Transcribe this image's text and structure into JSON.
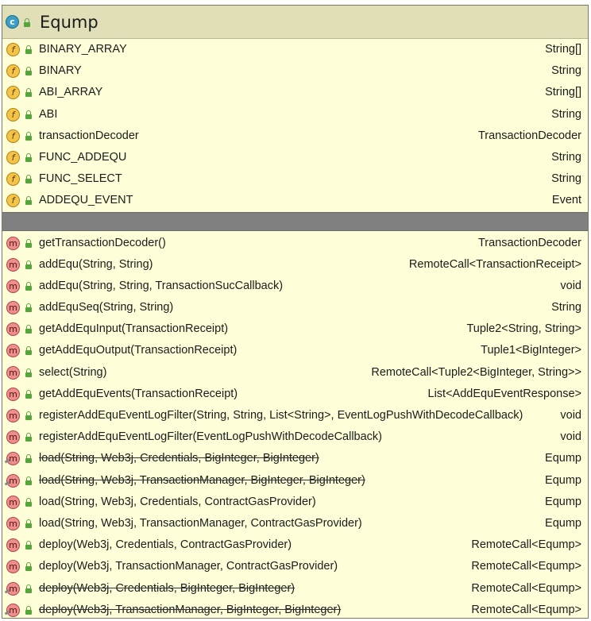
{
  "class": {
    "name": "Eqump",
    "icon": "class-icon",
    "icon_letter": "c"
  },
  "fields": [
    {
      "name": "BINARY_ARRAY",
      "type": "String[]"
    },
    {
      "name": "BINARY",
      "type": "String"
    },
    {
      "name": "ABI_ARRAY",
      "type": "String[]"
    },
    {
      "name": "ABI",
      "type": "String"
    },
    {
      "name": "transactionDecoder",
      "type": "TransactionDecoder"
    },
    {
      "name": "FUNC_ADDEQU",
      "type": "String"
    },
    {
      "name": "FUNC_SELECT",
      "type": "String"
    },
    {
      "name": "ADDEQU_EVENT",
      "type": "Event"
    }
  ],
  "methods": [
    {
      "name": "getTransactionDecoder()",
      "type": "TransactionDecoder",
      "deprecated": false
    },
    {
      "name": "addEqu(String, String)",
      "type": "RemoteCall<TransactionReceipt>",
      "deprecated": false
    },
    {
      "name": "addEqu(String, String, TransactionSucCallback)",
      "type": "void",
      "deprecated": false
    },
    {
      "name": "addEquSeq(String, String)",
      "type": "String",
      "deprecated": false
    },
    {
      "name": "getAddEquInput(TransactionReceipt)",
      "type": "Tuple2<String, String>",
      "deprecated": false
    },
    {
      "name": "getAddEquOutput(TransactionReceipt)",
      "type": "Tuple1<BigInteger>",
      "deprecated": false
    },
    {
      "name": "select(String)",
      "type": "RemoteCall<Tuple2<BigInteger, String>>",
      "deprecated": false
    },
    {
      "name": "getAddEquEvents(TransactionReceipt)",
      "type": "List<AddEquEventResponse>",
      "deprecated": false
    },
    {
      "name": "registerAddEquEventLogFilter(String, String, List<String>, EventLogPushWithDecodeCallback)",
      "type": "void",
      "deprecated": false
    },
    {
      "name": "registerAddEquEventLogFilter(EventLogPushWithDecodeCallback)",
      "type": "void",
      "deprecated": false
    },
    {
      "name": "load(String, Web3j, Credentials, BigInteger, BigInteger)",
      "type": "Eqump",
      "deprecated": true
    },
    {
      "name": "load(String, Web3j, TransactionManager, BigInteger, BigInteger)",
      "type": "Eqump",
      "deprecated": true
    },
    {
      "name": "load(String, Web3j, Credentials, ContractGasProvider)",
      "type": "Eqump",
      "deprecated": false
    },
    {
      "name": "load(String, Web3j, TransactionManager, ContractGasProvider)",
      "type": "Eqump",
      "deprecated": false
    },
    {
      "name": "deploy(Web3j, Credentials, ContractGasProvider)",
      "type": "RemoteCall<Eqump>",
      "deprecated": false
    },
    {
      "name": "deploy(Web3j, TransactionManager, ContractGasProvider)",
      "type": "RemoteCall<Eqump>",
      "deprecated": false
    },
    {
      "name": "deploy(Web3j, Credentials, BigInteger, BigInteger)",
      "type": "RemoteCall<Eqump>",
      "deprecated": true
    },
    {
      "name": "deploy(Web3j, TransactionManager, BigInteger, BigInteger)",
      "type": "RemoteCall<Eqump>",
      "deprecated": true
    }
  ],
  "icons": {
    "field": "field-icon",
    "method": "method-icon",
    "visibility": "public-lock-icon"
  },
  "colors": {
    "panel_bg": "#fefed8",
    "header_bg": "#e0dfb8",
    "separator": "#808080",
    "field_icon": "#f4c44a",
    "method_icon": "#ec8f8f",
    "class_icon": "#3c9ec4",
    "lock": "#56a43c"
  }
}
